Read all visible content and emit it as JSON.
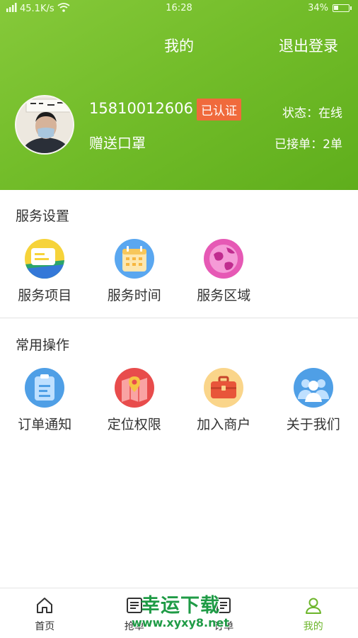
{
  "status_bar": {
    "signal": "2G",
    "network_speed": "45.1K/s",
    "time": "16:28",
    "battery": "34%",
    "battery_level": 0.34
  },
  "header": {
    "title": "我的",
    "logout_label": "退出登录"
  },
  "profile": {
    "phone": "15810012606",
    "verified_badge": "已认证",
    "status": "状态：在线",
    "gift": "赠送口罩",
    "orders_taken": "已接单：2单"
  },
  "service_settings": {
    "title": "服务设置",
    "items": [
      {
        "label": "服务项目",
        "icon": "service-items-icon"
      },
      {
        "label": "服务时间",
        "icon": "calendar-icon"
      },
      {
        "label": "服务区域",
        "icon": "globe-icon"
      }
    ]
  },
  "common_actions": {
    "title": "常用操作",
    "items": [
      {
        "label": "订单通知",
        "icon": "order-notice-icon"
      },
      {
        "label": "定位权限",
        "icon": "location-icon"
      },
      {
        "label": "加入商户",
        "icon": "briefcase-icon"
      },
      {
        "label": "关于我们",
        "icon": "people-icon"
      }
    ]
  },
  "tabbar": {
    "items": [
      {
        "label": "首页",
        "icon": "home-icon",
        "active": false
      },
      {
        "label": "抢单",
        "icon": "grab-order-icon",
        "active": false
      },
      {
        "label": "订单",
        "icon": "orders-icon",
        "active": false
      },
      {
        "label": "我的",
        "icon": "profile-icon",
        "active": true
      }
    ],
    "active_color": "#6cb52a"
  },
  "watermark": {
    "text": "幸运下载",
    "url": "www.xyxy8.net"
  },
  "colors": {
    "header_green": "#6cb52a",
    "badge_orange": "#f06a3c"
  }
}
